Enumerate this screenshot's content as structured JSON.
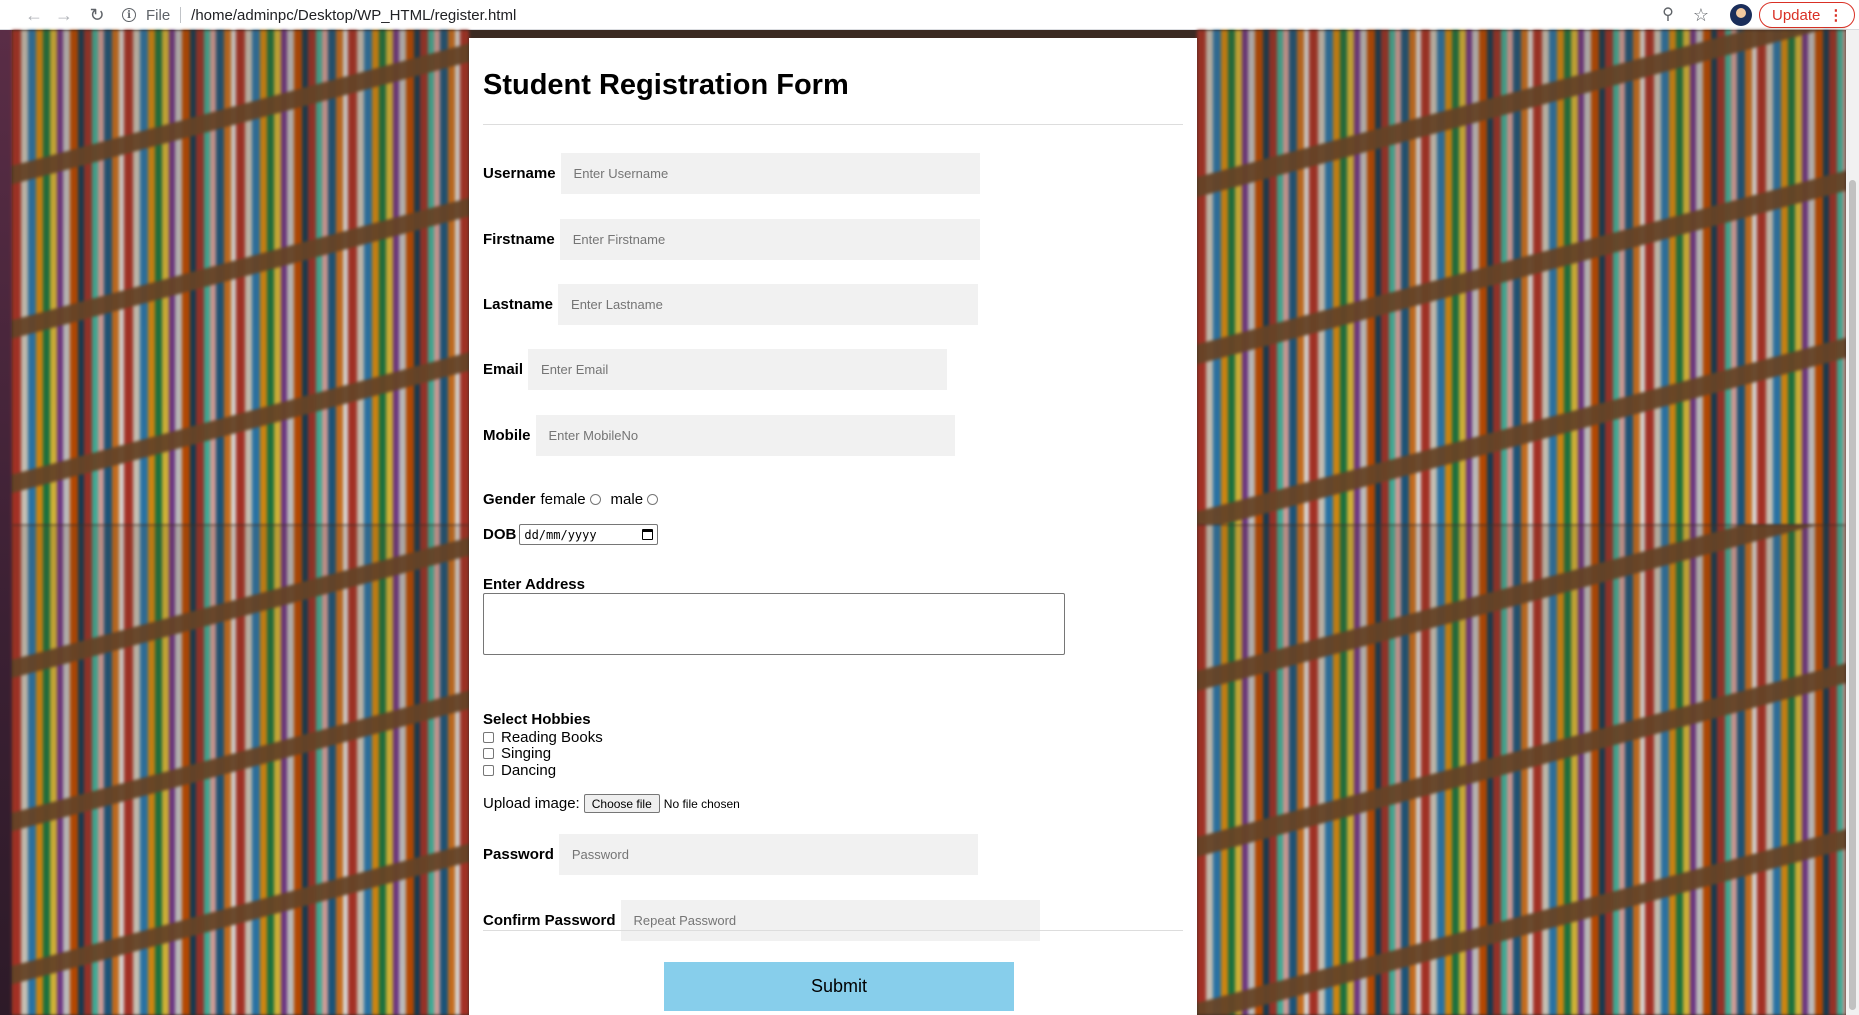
{
  "browser": {
    "scheme_label": "File",
    "url": "/home/adminpc/Desktop/WP_HTML/register.html",
    "update_label": "Update",
    "menu_glyph": "⋮",
    "icons": [
      "back-icon",
      "forward-icon",
      "reload-icon",
      "info-icon",
      "zoom-icon",
      "star-icon",
      "avatar",
      "menu-icon"
    ]
  },
  "form": {
    "title": "Student Registration Form",
    "username": {
      "label": "Username",
      "placeholder": "Enter Username"
    },
    "firstname": {
      "label": "Firstname",
      "placeholder": "Enter Firstname"
    },
    "lastname": {
      "label": "Lastname",
      "placeholder": "Enter Lastname"
    },
    "email": {
      "label": "Email",
      "placeholder": "Enter Email"
    },
    "mobile": {
      "label": "Mobile",
      "placeholder": "Enter MobileNo"
    },
    "gender": {
      "label": "Gender",
      "options": [
        "female",
        "male"
      ]
    },
    "dob": {
      "label": "DOB",
      "value": "dd/mm/yyyy"
    },
    "address": {
      "label": "Enter Address"
    },
    "hobbies": {
      "label": "Select Hobbies",
      "options": [
        "Reading Books",
        "Singing",
        "Dancing"
      ]
    },
    "upload": {
      "label": "Upload image:",
      "button": "Choose file",
      "status": "No file chosen"
    },
    "password": {
      "label": "Password",
      "placeholder": "Password"
    },
    "confirm_password": {
      "label": "Confirm Password",
      "placeholder": "Repeat Password"
    },
    "submit_label": "Submit"
  },
  "colors": {
    "submit_bg": "#87ceeb",
    "input_bg": "#f1f1f1",
    "update_red": "#d93025"
  }
}
